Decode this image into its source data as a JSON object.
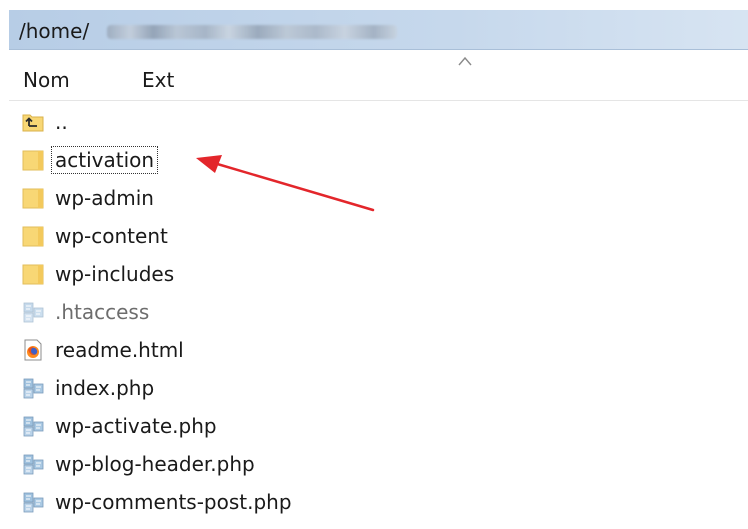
{
  "path_bar": {
    "path": "/home/"
  },
  "columns": {
    "name": "Nom",
    "ext": "Ext"
  },
  "files": [
    {
      "name": "..",
      "icon": "parent-folder-icon",
      "type": "parent"
    },
    {
      "name": "activation",
      "icon": "folder-icon",
      "type": "folder",
      "focused": true
    },
    {
      "name": "wp-admin",
      "icon": "folder-icon",
      "type": "folder"
    },
    {
      "name": "wp-content",
      "icon": "folder-icon",
      "type": "folder"
    },
    {
      "name": "wp-includes",
      "icon": "folder-icon",
      "type": "folder"
    },
    {
      "name": ".htaccess",
      "icon": "file-icon",
      "type": "hidden-file"
    },
    {
      "name": "readme.html",
      "icon": "firefox-html-icon",
      "type": "html"
    },
    {
      "name": "index.php",
      "icon": "file-icon",
      "type": "file"
    },
    {
      "name": "wp-activate.php",
      "icon": "file-icon",
      "type": "file"
    },
    {
      "name": "wp-blog-header.php",
      "icon": "file-icon",
      "type": "file"
    },
    {
      "name": "wp-comments-post.php",
      "icon": "file-icon",
      "type": "file"
    }
  ],
  "colors": {
    "path_bar": "#c6d8ec",
    "folder": "#f8d775",
    "annotation_arrow": "#e3262b"
  }
}
